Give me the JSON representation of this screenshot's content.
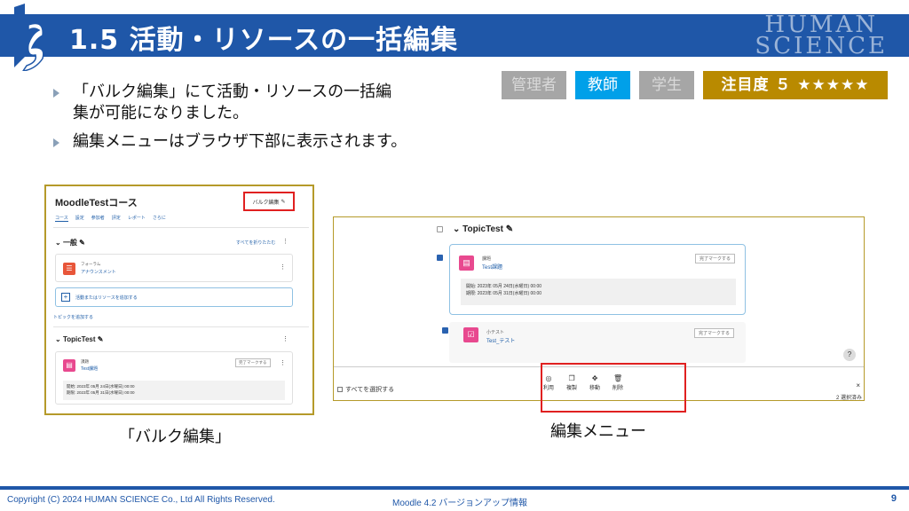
{
  "header": {
    "title": "1.5 活動・リソースの一括編集",
    "brand_line1": "HUMAN",
    "brand_line2": "SCIENCE"
  },
  "bullets": [
    "「バルク編集」にて活動・リソースの一括編集が可能になりました。",
    "編集メニューはブラウザ下部に表示されます。"
  ],
  "badges": {
    "admin": "管理者",
    "teacher": "教師",
    "student": "学生",
    "attention": "注目度 ５ ★★★★★"
  },
  "left_shot": {
    "course_title": "MoodleTestコース",
    "bulk_edit": "バルク編集",
    "tabs": [
      "コース",
      "設定",
      "参加者",
      "評定",
      "レポート",
      "さらに"
    ],
    "section_general": "一般",
    "collapse_all": "すべてを折りたたむ",
    "forum_type": "フォーラム",
    "forum_name": "アナウンスメント",
    "add_activity": "活動またはリソースを追加する",
    "add_topic": "トピックを追加する",
    "section_topic": "TopicTest",
    "assign_type": "課題",
    "assign_name": "Test課題",
    "mark_done": "完了マークする",
    "opened": "開始: 2023年 05月 24日(水曜日) 00:00",
    "due": "期限: 2023年 05月 31日(水曜日) 00:00"
  },
  "right_shot": {
    "topic_title": "TopicTest",
    "assign_type": "課題",
    "assign_name": "Test課題",
    "mark_done": "完了マークする",
    "opened": "開始: 2023年 05月 24日(水曜日) 00:00",
    "due": "期限: 2023年 05月 31日(水曜日) 00:00",
    "quiz_type": "小テスト",
    "quiz_name": "Test_テスト",
    "select_all": "すべてを選択する",
    "actions": [
      {
        "icon": "availability-icon",
        "glyph": "◎",
        "label": "利用"
      },
      {
        "icon": "duplicate-icon",
        "glyph": "❐",
        "label": "複製"
      },
      {
        "icon": "move-icon",
        "glyph": "✥",
        "label": "移動"
      },
      {
        "icon": "delete-icon",
        "glyph": "🗑",
        "label": "削除"
      }
    ],
    "close": "×",
    "selected_count": "2 選択済み",
    "help": "?"
  },
  "captions": {
    "left": "「バルク編集」",
    "right": "編集メニュー"
  },
  "footer": {
    "copyright": "Copyright (C) 2024 HUMAN SCIENCE Co., Ltd All Rights Reserved.",
    "middle": "Moodle 4.2 バージョンアップ情報",
    "page": "9"
  },
  "colors": {
    "brand_blue": "#1f57a8",
    "teacher_badge": "#00a0e9",
    "attention_badge": "#b98a00",
    "highlight_red": "#e02020"
  }
}
